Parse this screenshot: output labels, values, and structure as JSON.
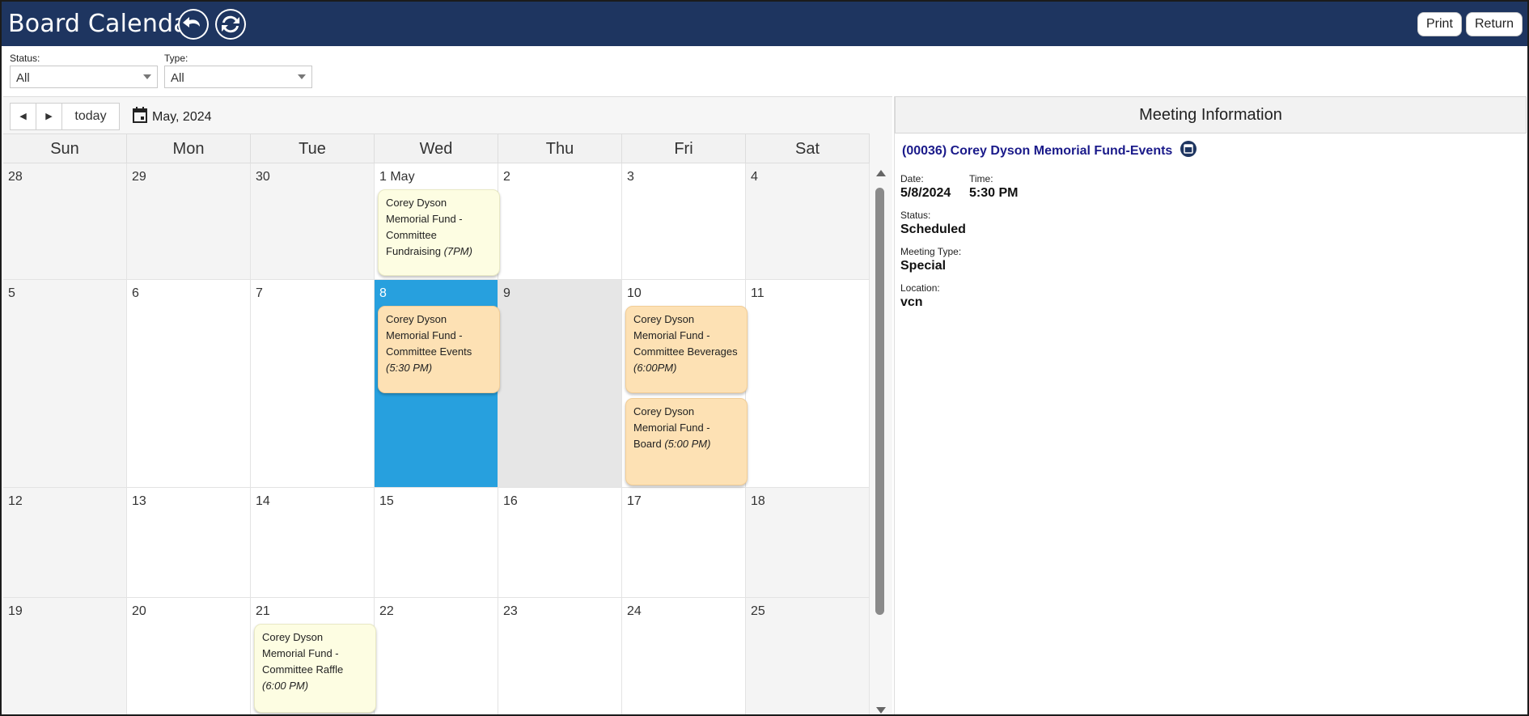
{
  "header": {
    "title": "Board Calendar",
    "print_label": "Print",
    "return_label": "Return"
  },
  "filters": {
    "status_label": "Status:",
    "status_value": "All",
    "type_label": "Type:",
    "type_value": "All"
  },
  "toolbar": {
    "prev_label": "◀",
    "next_label": "▶",
    "today_label": "today",
    "month_label": "May, 2024"
  },
  "days_of_week": [
    "Sun",
    "Mon",
    "Tue",
    "Wed",
    "Thu",
    "Fri",
    "Sat"
  ],
  "weeks": [
    [
      "28",
      "29",
      "30",
      "1 May",
      "2",
      "3",
      "4"
    ],
    [
      "5",
      "6",
      "7",
      "8",
      "9",
      "10",
      "11"
    ],
    [
      "12",
      "13",
      "14",
      "15",
      "16",
      "17",
      "18"
    ],
    [
      "19",
      "20",
      "21",
      "22",
      "23",
      "24",
      "25"
    ]
  ],
  "events": [
    {
      "title": "Corey Dyson Memorial Fund - Committee Fundraising",
      "time": "(7PM)"
    },
    {
      "title": "Corey Dyson Memorial Fund - Committee Events",
      "time": "(5:30 PM)"
    },
    {
      "title": "Corey Dyson Memorial Fund - Committee Beverages",
      "time": "(6:00PM)"
    },
    {
      "title": "Corey Dyson Memorial Fund - Board",
      "time": "(5:00 PM)"
    },
    {
      "title": "Corey Dyson Memorial Fund - Committee Raffle",
      "time": "(6:00 PM)"
    }
  ],
  "meeting_info": {
    "header": "Meeting Information",
    "title": "(00036) Corey Dyson Memorial Fund-Events",
    "date_label": "Date:",
    "date_value": "5/8/2024",
    "time_label": "Time:",
    "time_value": "5:30 PM",
    "status_label": "Status:",
    "status_value": "Scheduled",
    "type_label": "Meeting Type:",
    "type_value": "Special",
    "location_label": "Location:",
    "location_value": "vcn"
  },
  "colors": {
    "header_bg": "#1e3560",
    "today_bg": "#27a0de",
    "event_yellow": "#fdfde2",
    "event_orange": "#fde1b4",
    "link_color": "#1a1a8a"
  },
  "icons": {
    "undo": "undo-icon",
    "refresh": "refresh-icon",
    "calendar": "calendar-icon",
    "meeting": "meeting-details-icon"
  }
}
